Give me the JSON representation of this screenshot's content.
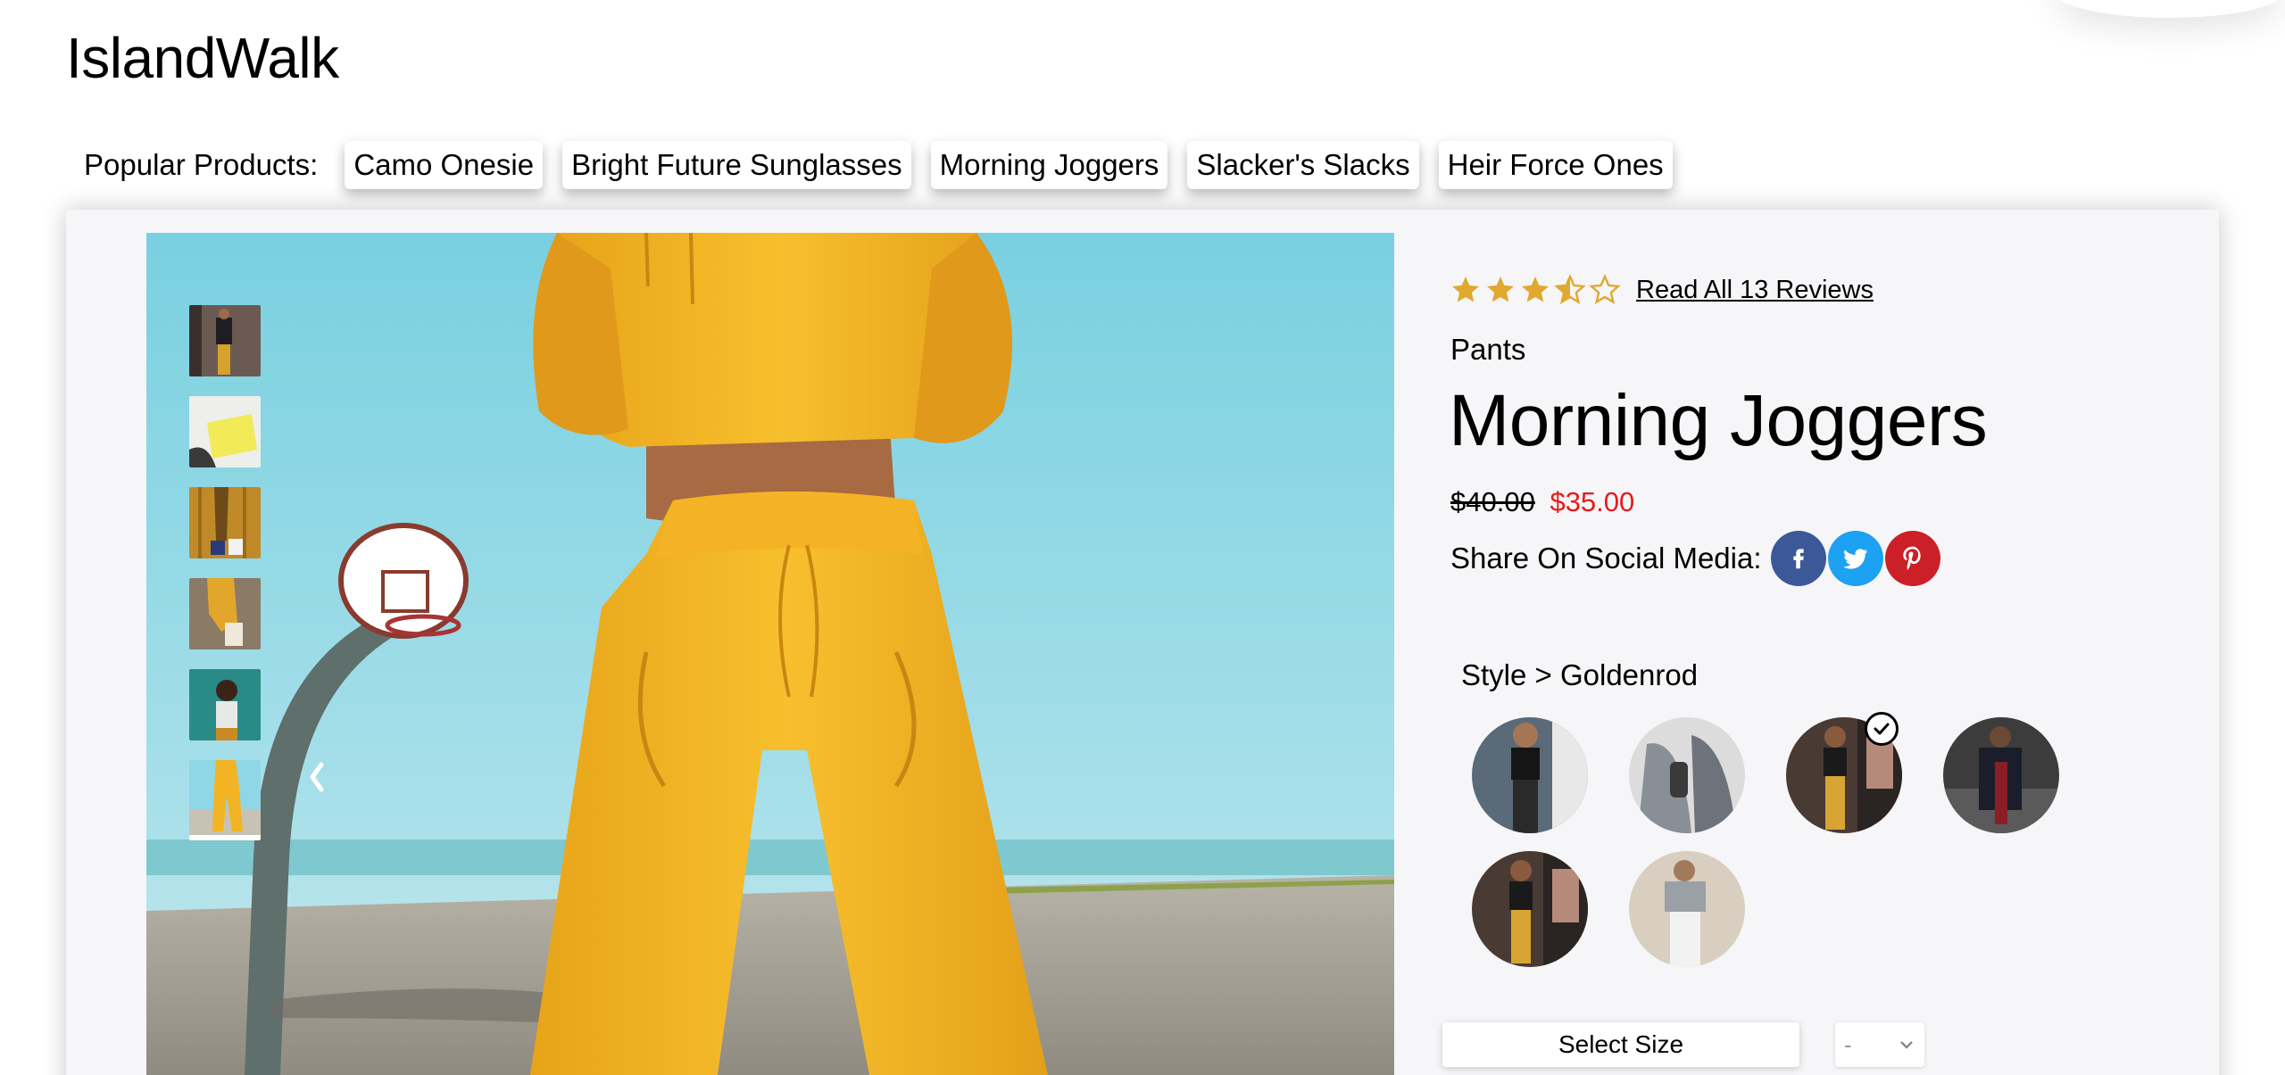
{
  "header": {
    "logo": "IslandWalk"
  },
  "popular": {
    "label": "Popular Products:",
    "items": [
      "Camo Onesie",
      "Bright Future Sunglasses",
      "Morning Joggers",
      "Slacker's Slacks",
      "Heir Force Ones"
    ]
  },
  "gallery": {
    "thumbnail_count": 6,
    "active_thumbnail": 6
  },
  "product": {
    "rating": 3.5,
    "rating_max": 5,
    "reviews_link": "Read All 13 Reviews",
    "category": "Pants",
    "name": "Morning Joggers",
    "original_price": "$40.00",
    "sale_price": "$35.00",
    "share_label": "Share On Social Media:",
    "social_icons": [
      "facebook-icon",
      "twitter-icon",
      "pinterest-icon"
    ],
    "style_label": "Style > Goldenrod",
    "style_count": 6,
    "selected_style": 3,
    "size_placeholder": "Select Size",
    "quantity_placeholder": "-"
  },
  "colors": {
    "card_bg": "#f6f6f8",
    "star": "#e0a82e",
    "sale": "#e81a1a",
    "facebook": "#3b5998",
    "twitter": "#1da1f2",
    "pinterest": "#cb2027"
  }
}
